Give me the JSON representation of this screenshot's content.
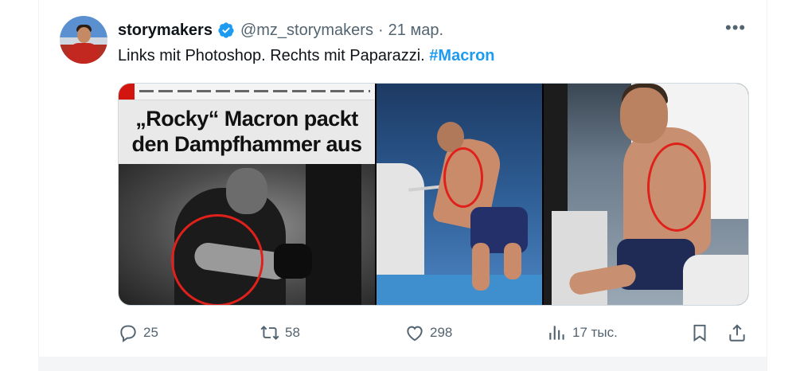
{
  "tweet": {
    "author_name": "storymakers",
    "handle": "@mz_storymakers",
    "separator": "·",
    "date": "21 мар.",
    "more_label": "•••",
    "text_main": "Links mit Photoshop. Rechts mit Paparazzi. ",
    "hashtag": "#Macron"
  },
  "media": {
    "left_headline": "„Rocky“ Macron packt den Dampfhammer aus"
  },
  "actions": {
    "replies": "25",
    "retweets": "58",
    "likes": "298",
    "views": "17 тыс."
  },
  "colors": {
    "accent": "#1d9bf0",
    "muted": "#536471",
    "circle": "#e0211b"
  },
  "icons": [
    "verified-badge-icon",
    "more-icon",
    "reply-icon",
    "retweet-icon",
    "like-icon",
    "views-icon",
    "bookmark-icon",
    "share-icon"
  ]
}
